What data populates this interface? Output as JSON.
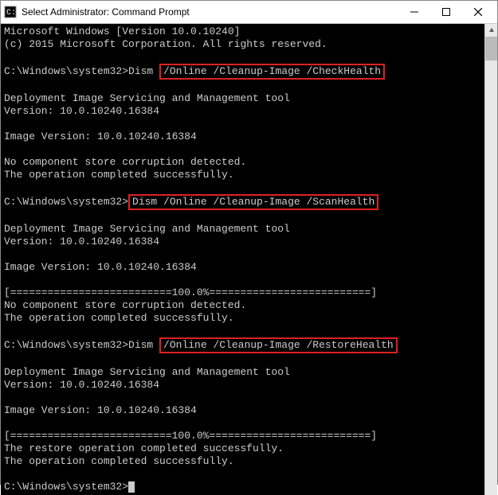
{
  "title": "Select Administrator: Command Prompt",
  "lines": {
    "l0": "Microsoft Windows [Version 10.0.10240]",
    "l1": "(c) 2015 Microsoft Corporation. All rights reserved.",
    "l2": "",
    "prompt1_pre": "C:\\Windows\\system32>Dism ",
    "prompt1_hl": "/Online /Cleanup-Image /CheckHealth",
    "l4": "",
    "l5": "Deployment Image Servicing and Management tool",
    "l6": "Version: 10.0.10240.16384",
    "l7": "",
    "l8": "Image Version: 10.0.10240.16384",
    "l9": "",
    "l10": "No component store corruption detected.",
    "l11": "The operation completed successfully.",
    "l12": "",
    "prompt2_pre": "C:\\Windows\\system32>",
    "prompt2_hl": "Dism /Online /Cleanup-Image /ScanHealth",
    "l14": "",
    "l15": "Deployment Image Servicing and Management tool",
    "l16": "Version: 10.0.10240.16384",
    "l17": "",
    "l18": "Image Version: 10.0.10240.16384",
    "l19": "",
    "l20": "[==========================100.0%==========================]",
    "l21": "No component store corruption detected.",
    "l22": "The operation completed successfully.",
    "l23": "",
    "prompt3_pre": "C:\\Windows\\system32>Dism ",
    "prompt3_hl": "/Online /Cleanup-Image /RestoreHealth",
    "l25": "",
    "l26": "Deployment Image Servicing and Management tool",
    "l27": "Version: 10.0.10240.16384",
    "l28": "",
    "l29": "Image Version: 10.0.10240.16384",
    "l30": "",
    "l31": "[==========================100.0%==========================]",
    "l32": "The restore operation completed successfully.",
    "l33": "The operation completed successfully.",
    "l34": "",
    "prompt4": "C:\\Windows\\system32>"
  }
}
